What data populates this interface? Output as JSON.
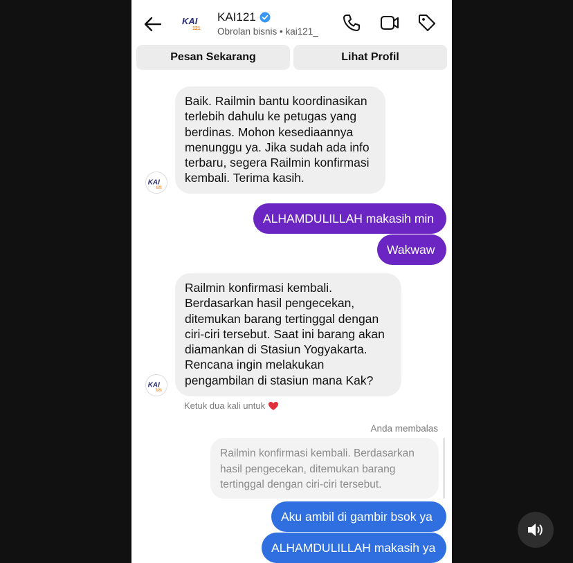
{
  "header": {
    "name": "KAI121",
    "subtitle": "Obrolan bisnis • kai121_",
    "logo_text": "KAI",
    "logo_sub": "121"
  },
  "actions": {
    "order_label": "Pesan Sekarang",
    "profile_label": "Lihat Profil"
  },
  "messages": {
    "m1": "Baik. Railmin bantu koordinasikan terlebih dahulu ke petugas yang berdinas. Mohon kesediaannya menunggu ya. Jika sudah ada info terbaru, segera Railmin konfirmasi kembali. Terima kasih.",
    "m2": "ALHAMDULILLAH makasih min",
    "m3": "Wakwaw",
    "m4": "Railmin konfirmasi kembali. Berdasarkan hasil pengecekan, ditemukan barang tertinggal dengan ciri-ciri tersebut. Saat ini barang akan diamankan di Stasiun Yogyakarta. Rencana ingin melakukan pengambilan di stasiun mana Kak?",
    "hint": "Ketuk dua kali untuk",
    "reply_note": "Anda membalas",
    "reply_quote": "Railmin konfirmasi kembali. Berdasarkan hasil pengecekan, ditemukan barang tertinggal dengan ciri-ciri tersebut.",
    "m5": "Aku ambil di gambir bsok ya",
    "m6": "ALHAMDULILLAH makasih ya"
  },
  "colors": {
    "outgoing_purple": "#6a25c2",
    "outgoing_blue": "#2f6fe0",
    "incoming_gray": "#efefef",
    "verified_blue": "#3897f0",
    "heart_red": "#e0303b",
    "logo_orange": "#f07b1e",
    "logo_navy": "#2a2f7a"
  },
  "icons": [
    "back-arrow-icon",
    "verified-badge-icon",
    "phone-icon",
    "video-icon",
    "tag-icon",
    "heart-icon",
    "speaker-icon"
  ]
}
